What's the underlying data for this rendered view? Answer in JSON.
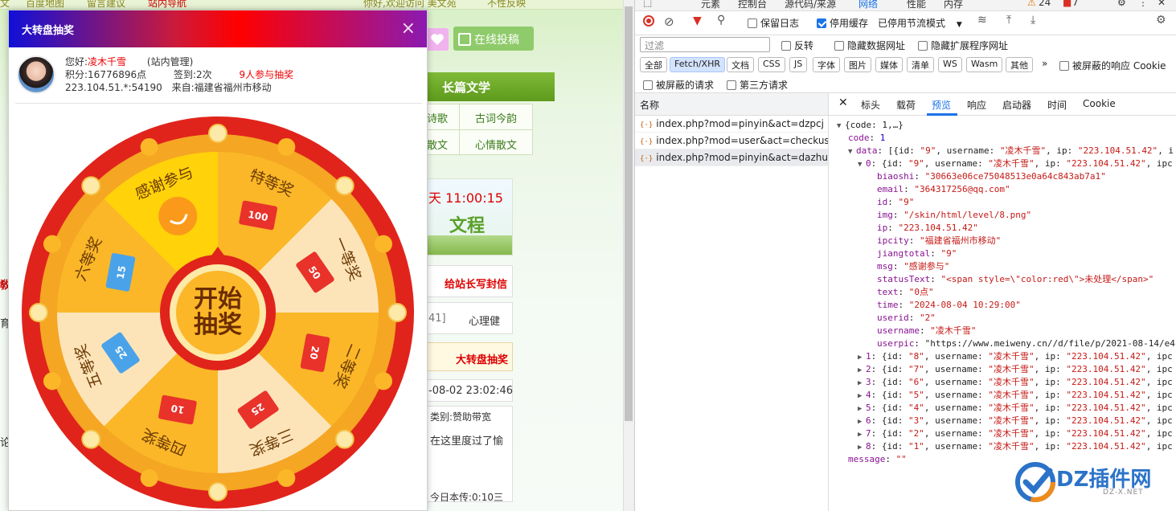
{
  "website": {
    "top_links": [
      "百度地图",
      "留言建议",
      "站内导航",
      "你好,欢迎访问 美文苑",
      "不性反映"
    ],
    "submit_button": "在线投稿",
    "nav_item": "长篇文学",
    "sub_nav": [
      "诗歌",
      "古词今韵",
      "散文",
      "心情散文"
    ],
    "date_time": "天  11:00:15",
    "banner_text": "文程",
    "write_to_admin": "给站长写封信",
    "bracket_text": "41]",
    "psych_text": "心理健",
    "lottery_link": "大转盘抽奖",
    "date_text": "-08-02 23:02:46",
    "category_text": "类别:赞助带宽",
    "snippet_text": "在这里度过了愉",
    "left_fragments": [
      "敎",
      "育",
      "论"
    ],
    "bottom_fragment": "今日本传:0:10三"
  },
  "modal": {
    "title": "大转盘抽奖",
    "close_label": "×",
    "user": {
      "greeting_label": "您好:",
      "name": "凌木千雪",
      "role": "(站内管理)",
      "points": "积分:16776896点",
      "signin": "签到:2次",
      "participants": "9人参与抽奖",
      "ip": "223.104.51.*:54190",
      "from": "来自:福建省福州市移动"
    },
    "wheel": {
      "center_line1": "开始",
      "center_line2": "抽奖",
      "prizes": [
        "特等奖",
        "一等奖",
        "二等奖",
        "三等奖",
        "四等奖",
        "五等奖",
        "六等奖",
        "感谢参与"
      ],
      "coupon_values": [
        "100",
        "50",
        "20",
        "25",
        "10",
        "25",
        "15",
        ""
      ]
    }
  },
  "devtools": {
    "top_tabs": [
      "元素",
      "控制台",
      "源代码/来源",
      "网络",
      "性能",
      "内存"
    ],
    "warn_count": "24",
    "err_count": "7",
    "toolbar": {
      "preserve_log": "保留日志",
      "disable_cache": "停用缓存",
      "throttle": "已停用节流模式"
    },
    "filter_placeholder": "过滤",
    "filter_options": [
      "反转",
      "隐藏数据网址",
      "隐藏扩展程序网址"
    ],
    "type_chips": [
      "全部",
      "Fetch/XHR",
      "文档",
      "CSS",
      "JS",
      "字体",
      "图片",
      "媒体",
      "清单",
      "WS",
      "Wasm",
      "其他"
    ],
    "blocked_cookies": "被屏蔽的响应 Cookie",
    "blocked_requests": "被屏蔽的请求",
    "third_party": "第三方请求",
    "name_header": "名称",
    "requests": [
      "index.php?mod=pinyin&act=dzpcj",
      "index.php?mod=user&act=checkuser",
      "index.php?mod=pinyin&act=dazhuan..."
    ],
    "detail_tabs": [
      "标头",
      "载荷",
      "预览",
      "响应",
      "启动器",
      "时间",
      "Cookie"
    ],
    "active_detail_tab": "预览",
    "json_lines": [
      "▼ {code: 1,…}",
      "code: 1",
      "▼ data: [{id: \"9\", username: \"凌木千雪\", ip: \"223.104.51.42\", i",
      "▼ 0: {id: \"9\", username: \"凌木千雪\", ip: \"223.104.51.42\", ipc",
      "biaoshi: \"30663e06ce75048513e0a64c843ab7a1\"",
      "email: \"364317256@qq.com\"",
      "id: \"9\"",
      "img: \"/skin/html/level/8.png\"",
      "ip: \"223.104.51.42\"",
      "ipcity: \"福建省福州市移动\"",
      "jiangtotal: \"9\"",
      "msg: \"感谢参与\"",
      "statusText: \"<span style=\\\"color:red\\\">未处理</span>\"",
      "text: \"0点\"",
      "time: \"2024-08-04 10:29:00\"",
      "userid: \"2\"",
      "username: \"凌木千雪\"",
      "userpic: \"https://www.meiweny.cn//d/file/p/2021-08-14/e4c",
      "▶ 1: {id: \"8\", username: \"凌木千雪\", ip: \"223.104.51.42\", ipc",
      "▶ 2: {id: \"7\", username: \"凌木千雪\", ip: \"223.104.51.42\", ipc",
      "▶ 3: {id: \"6\", username: \"凌木千雪\", ip: \"223.104.51.42\", ipc",
      "▶ 4: {id: \"5\", username: \"凌木千雪\", ip: \"223.104.51.42\", ipc",
      "▶ 5: {id: \"4\", username: \"凌木千雪\", ip: \"223.104.51.42\", ipc",
      "▶ 6: {id: \"3\", username: \"凌木千雪\", ip: \"223.104.51.42\", ipc",
      "▶ 7: {id: \"2\", username: \"凌木千雪\", ip: \"223.104.51.42\", ipc",
      "▶ 8: {id: \"1\", username: \"凌木千雪\", ip: \"223.104.51.42\", ipc",
      "message: \"\""
    ]
  },
  "watermark": {
    "brand": "DZ插件网",
    "domain": "DZ-X.NET"
  }
}
